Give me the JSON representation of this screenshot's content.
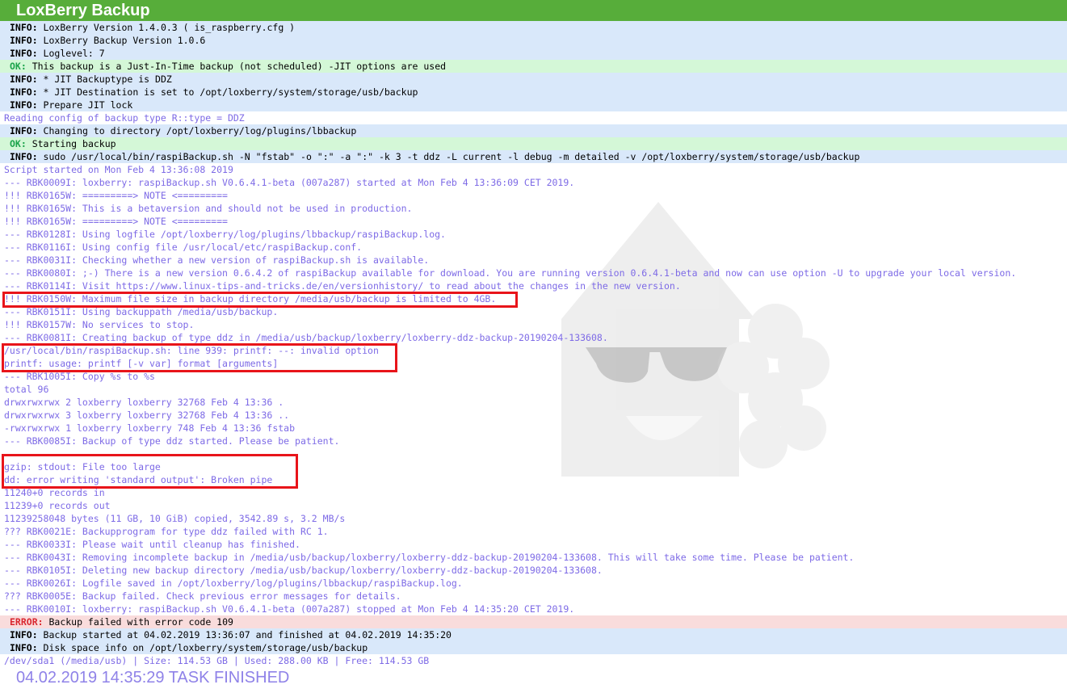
{
  "app": {
    "title": "LoxBerry Backup"
  },
  "log_lines": [
    {
      "type": "info",
      "level": "INFO:",
      "text": " LoxBerry Version 1.4.0.3 ( is_raspberry.cfg )"
    },
    {
      "type": "info",
      "level": "INFO:",
      "text": " LoxBerry Backup Version 1.0.6"
    },
    {
      "type": "info",
      "level": "INFO:",
      "text": " Loglevel: 7"
    },
    {
      "type": "ok",
      "level": "OK:",
      "text": " This backup is a Just-In-Time backup (not scheduled) -JIT options are used"
    },
    {
      "type": "info",
      "level": "INFO:",
      "text": " * JIT Backuptype is DDZ"
    },
    {
      "type": "info",
      "level": "INFO:",
      "text": " * JIT Destination is set to /opt/loxberry/system/storage/usb/backup"
    },
    {
      "type": "info",
      "level": "INFO:",
      "text": " Prepare JIT lock"
    },
    {
      "type": "plain",
      "level": "",
      "text": "Reading config of backup type R::type = DDZ"
    },
    {
      "type": "info",
      "level": "INFO:",
      "text": " Changing to directory /opt/loxberry/log/plugins/lbbackup"
    },
    {
      "type": "ok",
      "level": "OK:",
      "text": " Starting backup"
    },
    {
      "type": "info",
      "level": "INFO:",
      "text": " sudo /usr/local/bin/raspiBackup.sh -N \"fstab\" -o \":\" -a \":\" -k 3 -t ddz -L current -l debug -m detailed -v /opt/loxberry/system/storage/usb/backup"
    },
    {
      "type": "plain",
      "level": "",
      "text": "Script started on Mon Feb 4 13:36:08 2019"
    },
    {
      "type": "plain",
      "level": "",
      "text": "--- RBK0009I: loxberry: raspiBackup.sh V0.6.4.1-beta (007a287) started at Mon Feb 4 13:36:09 CET 2019."
    },
    {
      "type": "plain",
      "level": "",
      "text": "!!! RBK0165W: =========> NOTE <========="
    },
    {
      "type": "plain",
      "level": "",
      "text": "!!! RBK0165W: This is a betaversion and should not be used in production."
    },
    {
      "type": "plain",
      "level": "",
      "text": "!!! RBK0165W: =========> NOTE <========="
    },
    {
      "type": "plain",
      "level": "",
      "text": "--- RBK0128I: Using logfile /opt/loxberry/log/plugins/lbbackup/raspiBackup.log."
    },
    {
      "type": "plain",
      "level": "",
      "text": "--- RBK0116I: Using config file /usr/local/etc/raspiBackup.conf."
    },
    {
      "type": "plain",
      "level": "",
      "text": "--- RBK0031I: Checking whether a new version of raspiBackup.sh is available."
    },
    {
      "type": "plain",
      "level": "",
      "text": "--- RBK0080I: ;-) There is a new version 0.6.4.2 of raspiBackup available for download. You are running version 0.6.4.1-beta and now can use option -U to upgrade your local version."
    },
    {
      "type": "plain",
      "level": "",
      "text": "--- RBK0114I: Visit https://www.linux-tips-and-tricks.de/en/versionhistory/ to read about the changes in the new version."
    },
    {
      "type": "plain",
      "level": "",
      "text": "!!! RBK0150W: Maximum file size in backup directory /media/usb/backup is limited to 4GB."
    },
    {
      "type": "plain",
      "level": "",
      "text": "--- RBK0151I: Using backuppath /media/usb/backup."
    },
    {
      "type": "plain",
      "level": "",
      "text": "!!! RBK0157W: No services to stop."
    },
    {
      "type": "plain",
      "level": "",
      "text": "--- RBK0081I: Creating backup of type ddz in /media/usb/backup/loxberry/loxberry-ddz-backup-20190204-133608."
    },
    {
      "type": "plain",
      "level": "",
      "text": "/usr/local/bin/raspiBackup.sh: line 939: printf: --: invalid option"
    },
    {
      "type": "plain",
      "level": "",
      "text": "printf: usage: printf [-v var] format [arguments]"
    },
    {
      "type": "plain",
      "level": "",
      "text": "--- RBK1005I: Copy %s to %s"
    },
    {
      "type": "plain",
      "level": "",
      "text": "total 96"
    },
    {
      "type": "plain",
      "level": "",
      "text": "drwxrwxrwx 2 loxberry loxberry 32768 Feb 4 13:36 ."
    },
    {
      "type": "plain",
      "level": "",
      "text": "drwxrwxrwx 3 loxberry loxberry 32768 Feb 4 13:36 .."
    },
    {
      "type": "plain",
      "level": "",
      "text": "-rwxrwxrwx 1 loxberry loxberry 748 Feb 4 13:36 fstab"
    },
    {
      "type": "plain",
      "level": "",
      "text": "--- RBK0085I: Backup of type ddz started. Please be patient."
    },
    {
      "type": "plain",
      "level": "",
      "text": ""
    },
    {
      "type": "plain",
      "level": "",
      "text": "gzip: stdout: File too large"
    },
    {
      "type": "plain",
      "level": "",
      "text": "dd: error writing 'standard output': Broken pipe"
    },
    {
      "type": "plain",
      "level": "",
      "text": "11240+0 records in"
    },
    {
      "type": "plain",
      "level": "",
      "text": "11239+0 records out"
    },
    {
      "type": "plain",
      "level": "",
      "text": "11239258048 bytes (11 GB, 10 GiB) copied, 3542.89 s, 3.2 MB/s"
    },
    {
      "type": "plain",
      "level": "",
      "text": "??? RBK0021E: Backupprogram for type ddz failed with RC 1."
    },
    {
      "type": "plain",
      "level": "",
      "text": "--- RBK0033I: Please wait until cleanup has finished."
    },
    {
      "type": "plain",
      "level": "",
      "text": "--- RBK0043I: Removing incomplete backup in /media/usb/backup/loxberry/loxberry-ddz-backup-20190204-133608. This will take some time. Please be patient."
    },
    {
      "type": "plain",
      "level": "",
      "text": "--- RBK0105I: Deleting new backup directory /media/usb/backup/loxberry/loxberry-ddz-backup-20190204-133608."
    },
    {
      "type": "plain",
      "level": "",
      "text": "--- RBK0026I: Logfile saved in /opt/loxberry/log/plugins/lbbackup/raspiBackup.log."
    },
    {
      "type": "plain",
      "level": "",
      "text": "??? RBK0005E: Backup failed. Check previous error messages for details."
    },
    {
      "type": "plain",
      "level": "",
      "text": "--- RBK0010I: loxberry: raspiBackup.sh V0.6.4.1-beta (007a287) stopped at Mon Feb 4 14:35:20 CET 2019."
    },
    {
      "type": "error",
      "level": "ERROR:",
      "text": " Backup failed with error code 109"
    },
    {
      "type": "info",
      "level": "INFO:",
      "text": " Backup started at 04.02.2019 13:36:07 and finished at 04.02.2019 14:35:20"
    },
    {
      "type": "info",
      "level": "INFO:",
      "text": " Disk space info on /opt/loxberry/system/storage/usb/backup"
    },
    {
      "type": "plain",
      "level": "",
      "text": "/dev/sda1 (/media/usb) | Size: 114.53 GB | Used: 288.00 KB | Free: 114.53 GB"
    }
  ],
  "finished": {
    "text": "04.02.2019 14:35:29 TASK FINISHED"
  },
  "colors": {
    "title_bar": "#57ad3a",
    "info_bg": "#d9e8fa",
    "ok_bg": "#d4f7d7",
    "error_bg": "#f9dcdc",
    "plain_text": "#7d6ae6",
    "highlight_box": "#e8141a"
  }
}
